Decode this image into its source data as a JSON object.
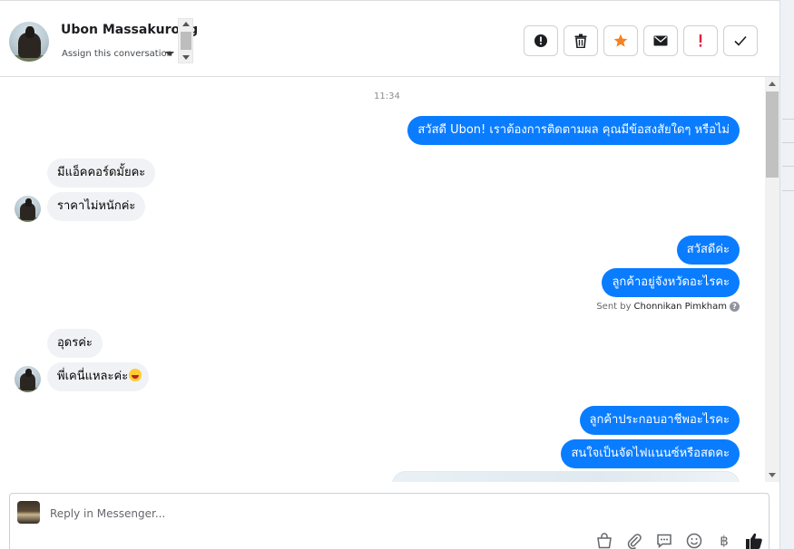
{
  "header": {
    "contact_name": "Ubon Massakurong",
    "assign_label": "Assign this conversation",
    "actions": [
      {
        "name": "report-icon"
      },
      {
        "name": "trash-icon"
      },
      {
        "name": "star-icon"
      },
      {
        "name": "mail-icon"
      },
      {
        "name": "exclamation-icon"
      },
      {
        "name": "check-icon"
      }
    ]
  },
  "conversation": {
    "timestamp": "11:34",
    "messages": [
      {
        "dir": "out",
        "text": "สวัสดี Ubon! เราต้องการติดตามผล คุณมีข้อสงสัยใดๆ หรือไม่"
      },
      {
        "dir": "in",
        "text": "มีแอ็คคอร์ดมั้ยคะ"
      },
      {
        "dir": "in",
        "text": "ราคาไม่หนักค่ะ"
      },
      {
        "dir": "out",
        "text": "สวัสดีค่ะ"
      },
      {
        "dir": "out",
        "text": "ลูกค้าอยู่จังหวัดอะไรคะ"
      },
      {
        "dir": "in",
        "text": "อุดรค่ะ"
      },
      {
        "dir": "in",
        "text": "พี่เคนี่แหละค่ะ"
      },
      {
        "dir": "out",
        "text": "ลูกค้าประกอบอาชีพอะไรคะ"
      },
      {
        "dir": "out",
        "text": "สนใจเป็นจัดไฟแนนซ์หรือสดคะ"
      }
    ],
    "sent_by_prefix": "Sent by",
    "sent_by_name": "Chonnikan Pimkham",
    "help_glyph": "?"
  },
  "reply": {
    "placeholder": "Reply in Messenger...",
    "tools": [
      "bag-icon",
      "paperclip-icon",
      "chat-bubble-icon",
      "smiley-icon",
      "baht-icon",
      "thumbs-up-icon"
    ],
    "baht_glyph": "฿"
  },
  "colors": {
    "outgoing_bubble": "#0a7cff",
    "incoming_bubble": "#f0f2f5",
    "star": "#f58220",
    "exclamation": "#e41e3f"
  }
}
